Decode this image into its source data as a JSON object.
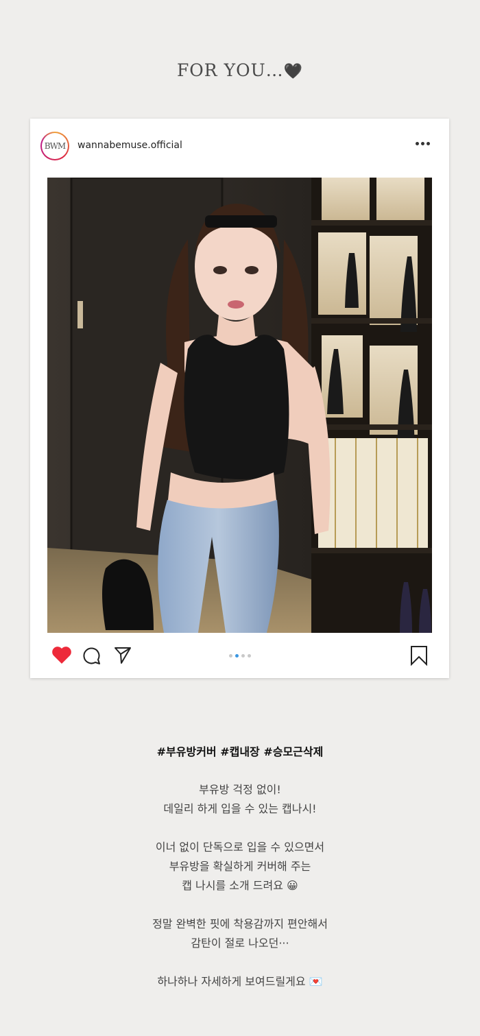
{
  "header": {
    "title": "FOR YOU…",
    "title_emoji": "🖤"
  },
  "post": {
    "avatar_text": "BWM",
    "username": "wannabemuse.official",
    "more_icon": "more-horizontal-icon",
    "image_alt": "model wearing black cropped tank top and light blue jeans",
    "carousel": {
      "count": 4,
      "active_index": 1
    },
    "actions": [
      "heart-icon",
      "comment-icon",
      "send-icon",
      "bookmark-icon"
    ],
    "colors": {
      "heart": "#ed2a3a",
      "active_dot": "#3b97e2"
    }
  },
  "caption": {
    "tags": "#부유방커버 #캡내장 #승모근삭제",
    "paragraph1": [
      "부유방 걱정 없이!",
      "데일리 하게 입을 수 있는 캡나시!"
    ],
    "paragraph2": [
      "이너 없이 단독으로 입을 수 있으면서",
      "부유방을 확실하게 커버해 주는",
      "캡 나시를 소개 드려요 😀"
    ],
    "paragraph3": [
      "정말 완벽한 핏에 착용감까지 편안해서",
      "감탄이 절로 나오던···"
    ],
    "paragraph4": [
      "하나하나 자세하게 보여드릴게요 💌"
    ]
  }
}
